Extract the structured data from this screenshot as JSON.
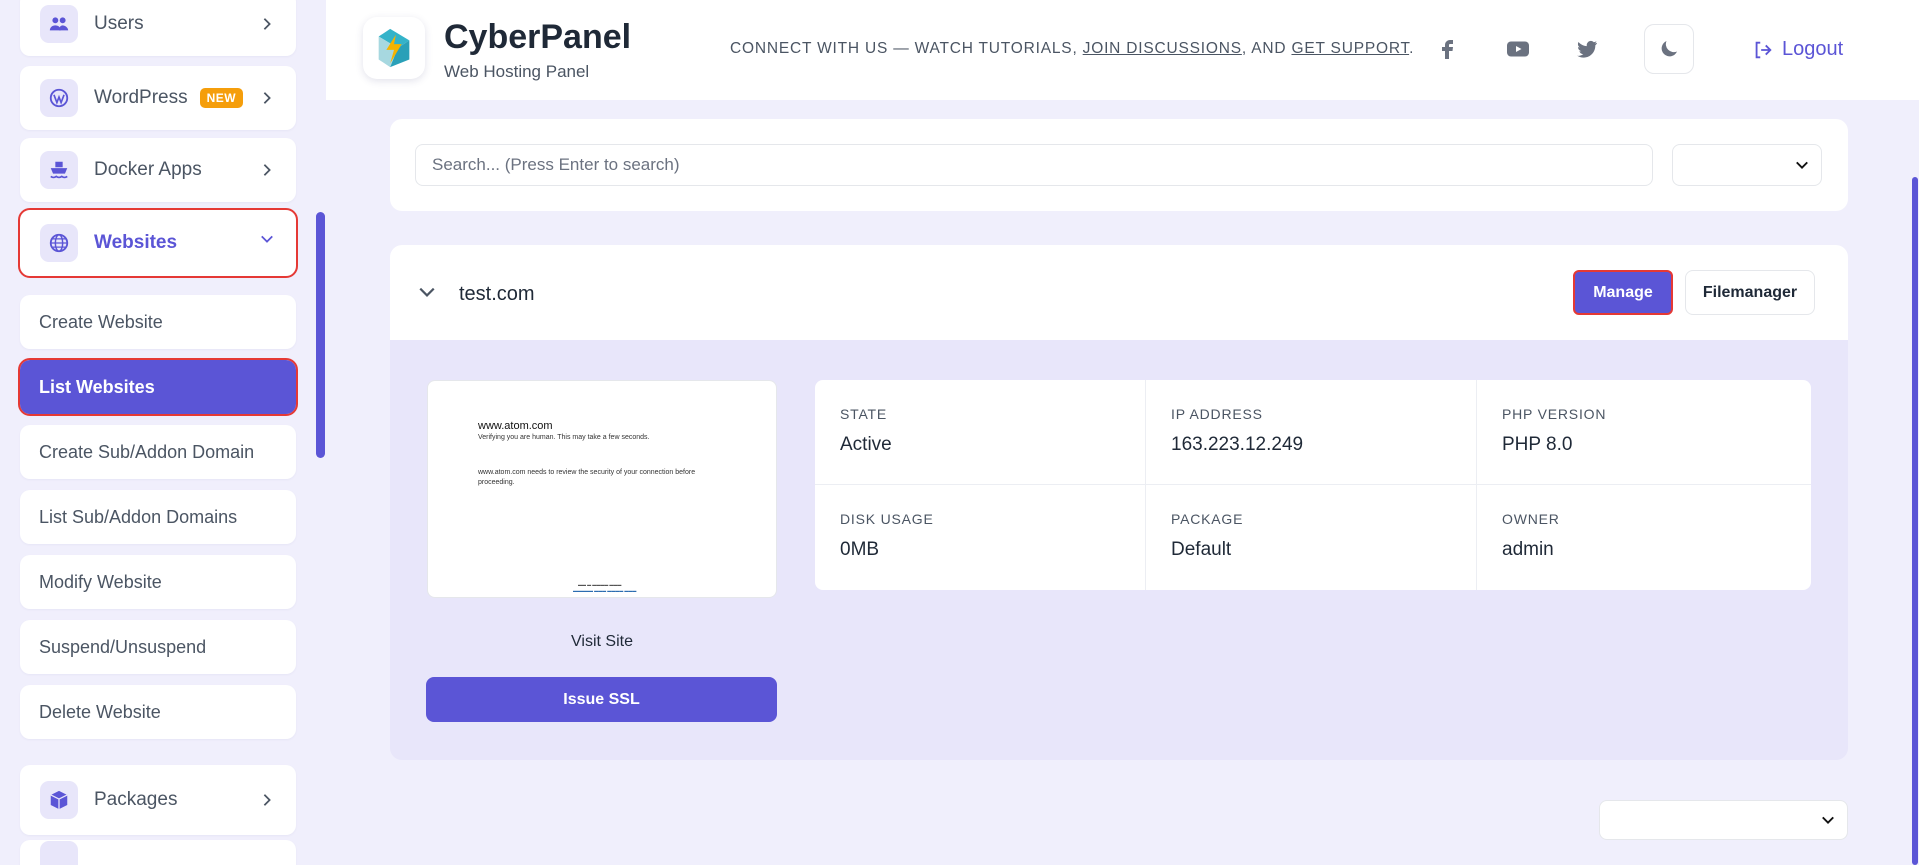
{
  "colors": {
    "accent": "#5b55d6",
    "highlight": "#e53935",
    "badge": "#f59e0b"
  },
  "sidebar": {
    "items": [
      {
        "label": "Users",
        "icon": "users-icon"
      },
      {
        "label": "WordPress",
        "badge": "NEW",
        "icon": "wordpress-icon"
      },
      {
        "label": "Docker Apps",
        "icon": "ship-icon"
      },
      {
        "label": "Websites",
        "icon": "globe-icon"
      },
      {
        "label": "Packages",
        "icon": "box-icon"
      }
    ],
    "websites_sub": [
      "Create Website",
      "List Websites",
      "Create Sub/Addon Domain",
      "List Sub/Addon Domains",
      "Modify Website",
      "Suspend/Unsuspend",
      "Delete Website"
    ]
  },
  "header": {
    "brand": "CyberPanel",
    "tagline": "Web Hosting Panel",
    "connect_prefix": "CONNECT WITH US — WATCH TUTORIALS, ",
    "join": "JOIN DISCUSSIONS",
    "connect_mid": ", AND ",
    "support": "GET SUPPORT",
    "connect_suffix": ".",
    "logout": "Logout"
  },
  "search": {
    "placeholder": "Search... (Press Enter to search)"
  },
  "site": {
    "domain": "test.com",
    "manage": "Manage",
    "filemanager": "Filemanager",
    "preview": {
      "title": "www.atom.com",
      "line1": "Verifying you are human. This may take a few seconds.",
      "line2": "www.atom.com needs to review the security of your connection before proceeding."
    },
    "visit": "Visit Site",
    "issue_ssl": "Issue SSL",
    "info": [
      {
        "label": "STATE",
        "value": "Active"
      },
      {
        "label": "IP ADDRESS",
        "value": "163.223.12.249"
      },
      {
        "label": "PHP VERSION",
        "value": "PHP 8.0"
      },
      {
        "label": "DISK USAGE",
        "value": "0MB"
      },
      {
        "label": "PACKAGE",
        "value": "Default"
      },
      {
        "label": "OWNER",
        "value": "admin"
      }
    ]
  }
}
